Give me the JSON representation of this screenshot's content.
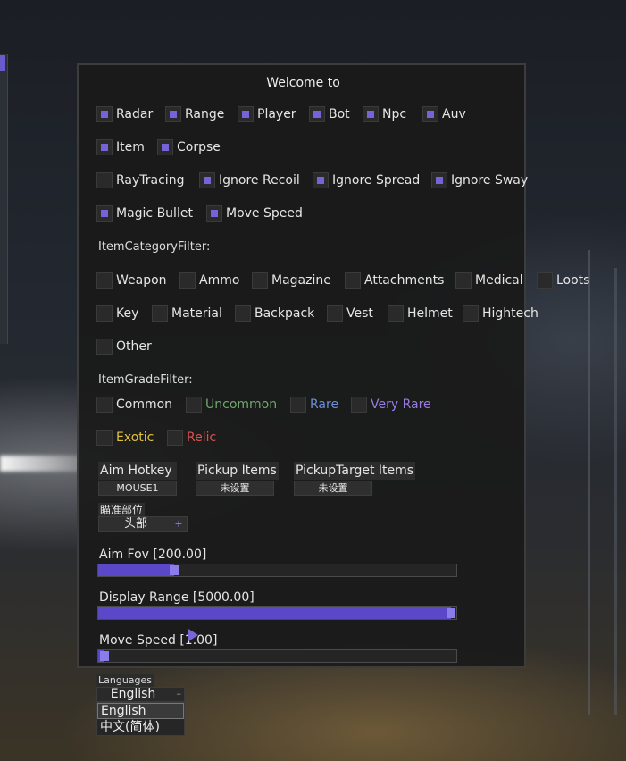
{
  "title": "Welcome to",
  "accent_color": "#7563d8",
  "features": [
    {
      "label": "Radar",
      "checked": true
    },
    {
      "label": "Range",
      "checked": true
    },
    {
      "label": "Player",
      "checked": true
    },
    {
      "label": "Bot",
      "checked": true
    },
    {
      "label": "Npc",
      "checked": true
    },
    {
      "label": "Auv",
      "checked": true
    },
    {
      "label": "Item",
      "checked": true
    },
    {
      "label": "Corpse",
      "checked": true
    },
    {
      "label": "RayTracing",
      "checked": false
    },
    {
      "label": "Ignore Recoil",
      "checked": true
    },
    {
      "label": "Ignore Spread",
      "checked": true
    },
    {
      "label": "Ignore Sway",
      "checked": true
    },
    {
      "label": "Magic Bullet",
      "checked": true
    },
    {
      "label": "Move Speed",
      "checked": true
    }
  ],
  "category_filter": {
    "heading": "ItemCategoryFilter:",
    "items": [
      {
        "label": "Weapon",
        "checked": false
      },
      {
        "label": "Ammo",
        "checked": false
      },
      {
        "label": "Magazine",
        "checked": false
      },
      {
        "label": "Attachments",
        "checked": false
      },
      {
        "label": "Medical",
        "checked": false
      },
      {
        "label": "Loots",
        "checked": false
      },
      {
        "label": "Key",
        "checked": false
      },
      {
        "label": "Material",
        "checked": false
      },
      {
        "label": "Backpack",
        "checked": false
      },
      {
        "label": "Vest",
        "checked": false
      },
      {
        "label": "Helmet",
        "checked": false
      },
      {
        "label": "Hightech",
        "checked": false
      },
      {
        "label": "Other",
        "checked": false
      }
    ]
  },
  "grade_filter": {
    "heading": "ItemGradeFilter:",
    "items": [
      {
        "label": "Common",
        "checked": false,
        "color": "#e6e6e6"
      },
      {
        "label": "Uncommon",
        "checked": false,
        "color": "#6fa86a"
      },
      {
        "label": "Rare",
        "checked": false,
        "color": "#6b8fd6"
      },
      {
        "label": "Very Rare",
        "checked": false,
        "color": "#9a7ce0"
      },
      {
        "label": "Exotic",
        "checked": false,
        "color": "#e0c23a"
      },
      {
        "label": "Relic",
        "checked": false,
        "color": "#d9534f"
      }
    ]
  },
  "hotkeys": [
    {
      "label": "Aim Hotkey",
      "value": "MOUSE1"
    },
    {
      "label": "Pickup Items",
      "value": "未设置"
    },
    {
      "label": "PickupTarget Items",
      "value": "未设置"
    }
  ],
  "aim_part": {
    "label": "瞄准部位",
    "value": "头部",
    "arrow": "+"
  },
  "sliders": [
    {
      "label": "Aim Fov [200.00]",
      "fraction": 0.2
    },
    {
      "label": "Display Range [5000.00]",
      "fraction": 1.0
    },
    {
      "label": "Move Speed [1.00]",
      "fraction": 0.0
    }
  ],
  "languages": {
    "label": "Languages",
    "selected": "English",
    "arrow": "–",
    "options": [
      "English",
      "中文(简体)"
    ]
  }
}
